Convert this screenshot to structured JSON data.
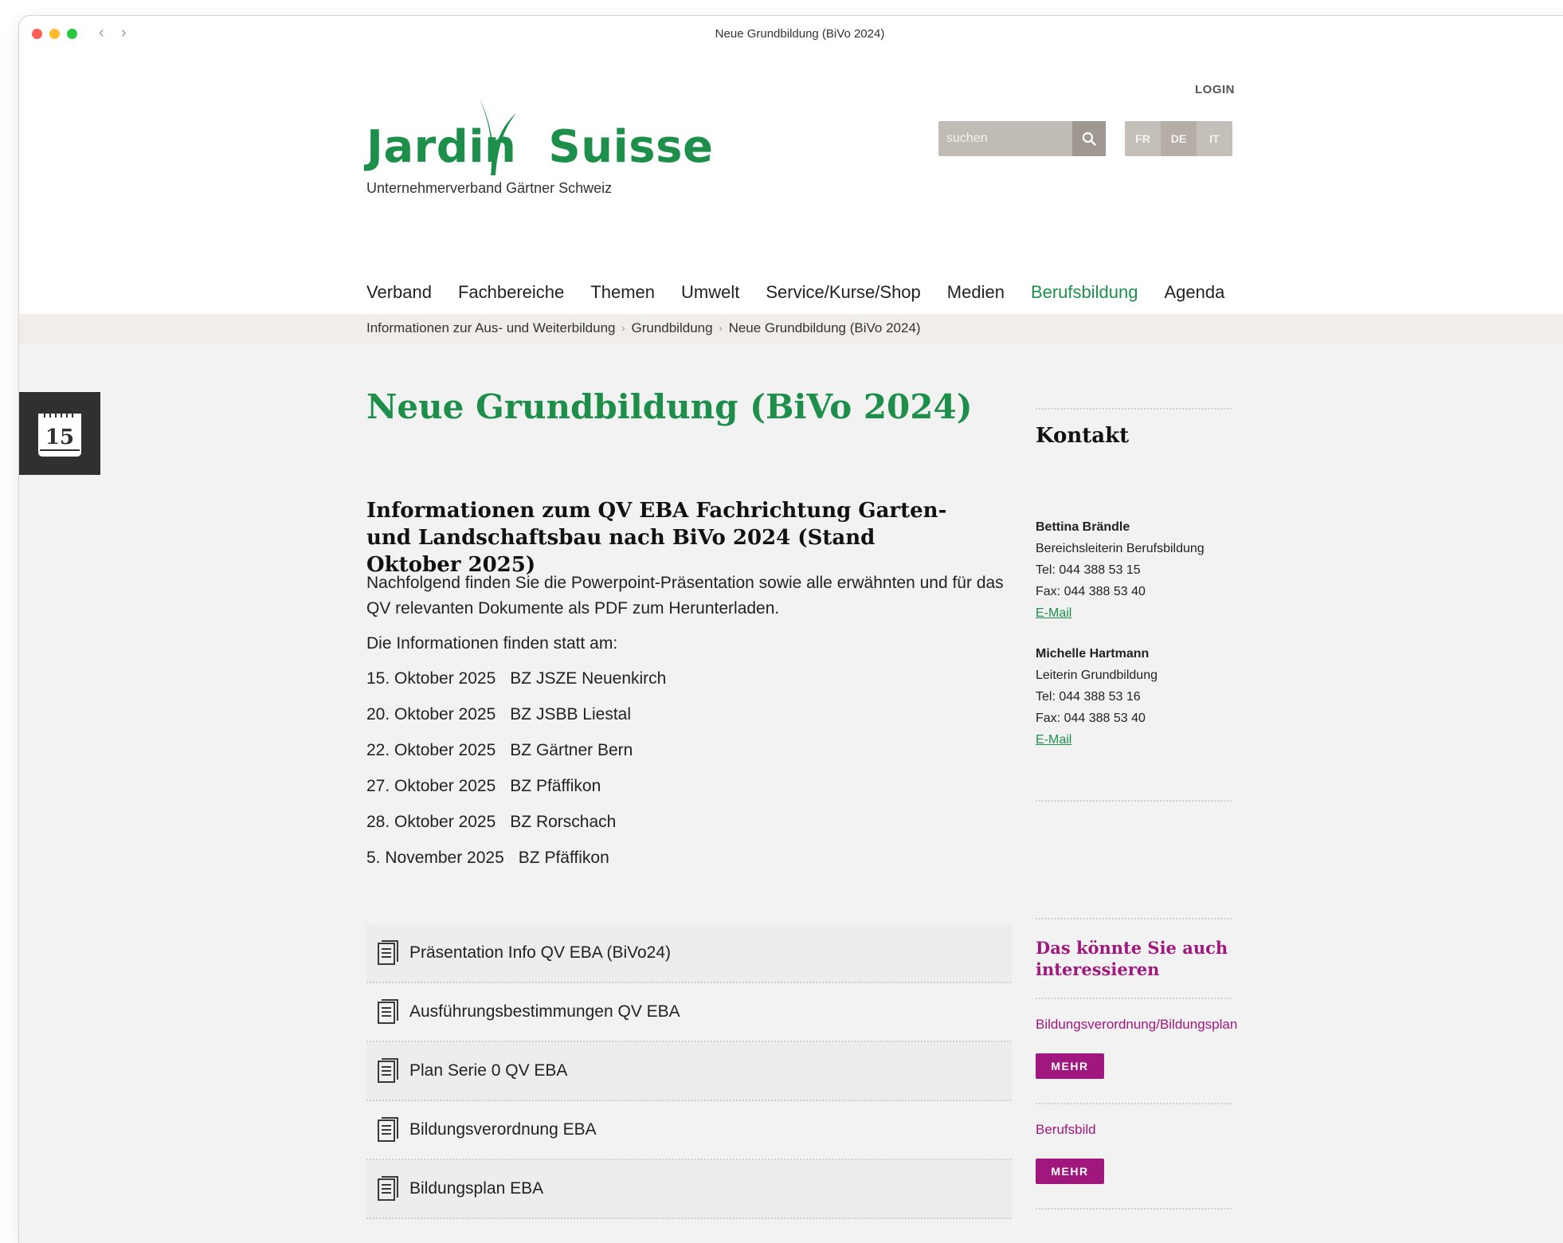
{
  "window": {
    "title": "Neue Grundbildung (BiVo 2024)"
  },
  "header": {
    "logo_left": "Jardin",
    "logo_right": "Suisse",
    "logo_subtitle": "Unternehmerverband Gärtner Schweiz",
    "login": "LOGIN",
    "search_placeholder": "suchen",
    "languages": [
      "FR",
      "DE",
      "IT"
    ],
    "active_language": "DE"
  },
  "nav": {
    "items": [
      "Verband",
      "Fachbereiche",
      "Themen",
      "Umwelt",
      "Service/Kurse/Shop",
      "Medien",
      "Berufsbildung",
      "Agenda"
    ],
    "current": "Berufsbildung"
  },
  "breadcrumb": [
    "Informationen zur Aus- und Weiterbildung",
    "Grundbildung",
    "Neue Grundbildung (BiVo 2024)"
  ],
  "calendar_widget": {
    "day": "15"
  },
  "main": {
    "title": "Neue Grundbildung (BiVo 2024)",
    "section_title": "Informationen zum QV EBA Fachrichtung Garten- und Landschaftsbau nach BiVo 2024 (Stand Oktober 2025)",
    "intro": "Nachfolgend finden Sie die Powerpoint-Präsentation sowie alle erwähnten und für das QV relevanten Dokumente als PDF zum Herunterladen.",
    "dates_intro": "Die Informationen finden statt am:",
    "dates": [
      {
        "date": "15. Oktober 2025",
        "place": "BZ JSZE Neuenkirch"
      },
      {
        "date": "20. Oktober 2025",
        "place": "BZ JSBB Liestal"
      },
      {
        "date": "22. Oktober 2025",
        "place": "BZ Gärtner Bern"
      },
      {
        "date": "27. Oktober 2025",
        "place": "BZ Pfäffikon"
      },
      {
        "date": "28. Oktober 2025",
        "place": "BZ Rorschach"
      },
      {
        "date": "5. November 2025",
        "place": "BZ Pfäffikon"
      }
    ],
    "documents": [
      "Präsentation Info QV EBA (BiVo24)",
      "Ausführungsbestimmungen QV EBA",
      "Plan Serie 0 QV EBA",
      "Bildungsverordnung EBA",
      "Bildungsplan EBA"
    ]
  },
  "sidebar": {
    "contact_title": "Kontakt",
    "contacts": [
      {
        "name": "Bettina Brändle",
        "role": "Bereichsleiterin Berufsbildung",
        "tel": "Tel: 044 388 53 15",
        "fax": "Fax: 044 388 53 40",
        "email": "E-Mail"
      },
      {
        "name": "Michelle Hartmann",
        "role": "Leiterin Grundbildung",
        "tel": "Tel: 044 388 53 16",
        "fax": "Fax: 044 388 53 40",
        "email": "E-Mail"
      }
    ],
    "related_title": "Das könnte Sie auch interessieren",
    "related": [
      {
        "label": "Bildungsverordnung/Bildungsplan",
        "button": "MEHR"
      },
      {
        "label": "Berufsbild",
        "button": "MEHR"
      }
    ]
  },
  "colors": {
    "brand_green": "#1e8f4a",
    "accent_magenta": "#a0177d"
  }
}
